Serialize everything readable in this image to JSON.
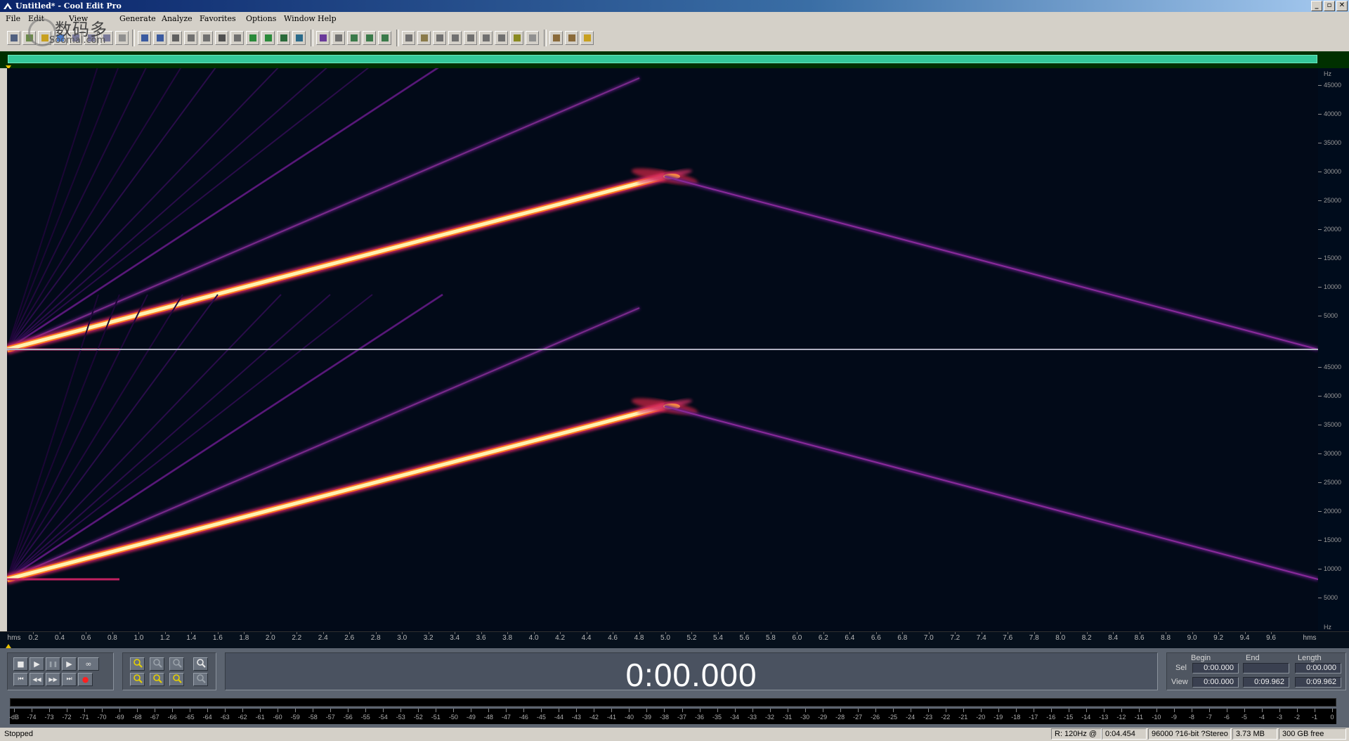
{
  "window": {
    "title": "Untitled* - Cool Edit Pro",
    "controls": [
      "_",
      "▫",
      "✕"
    ]
  },
  "menu": [
    "File",
    "Edit",
    "View",
    "Generate",
    "Analyze",
    "Favorites",
    "Options",
    "Window",
    "Help"
  ],
  "watermark": {
    "cn": "数码多",
    "en": "Soomal.com"
  },
  "spectral": {
    "unit_top": "Hz",
    "unit_bottom": "Hz",
    "freq_labels": [
      "45000",
      "40000",
      "35000",
      "30000",
      "25000",
      "20000",
      "15000",
      "10000",
      "5000"
    ],
    "colors": {
      "background": "#020a18",
      "hot": "#fff6c8",
      "warm": "#ff6a1a",
      "mid": "#c4206a",
      "cool": "#6a1a8a",
      "faint": "#3a1060"
    }
  },
  "timeline": {
    "start_label": "hms",
    "end_label": "hms",
    "ticks": [
      "0.2",
      "0.4",
      "0.6",
      "0.8",
      "1.0",
      "1.2",
      "1.4",
      "1.6",
      "1.8",
      "2.0",
      "2.2",
      "2.4",
      "2.6",
      "2.8",
      "3.0",
      "3.2",
      "3.4",
      "3.6",
      "3.8",
      "4.0",
      "4.2",
      "4.4",
      "4.6",
      "4.8",
      "5.0",
      "5.2",
      "5.4",
      "5.6",
      "5.8",
      "6.0",
      "6.2",
      "6.4",
      "6.6",
      "6.8",
      "7.0",
      "7.2",
      "7.4",
      "7.6",
      "7.8",
      "8.0",
      "8.2",
      "8.4",
      "8.6",
      "8.8",
      "9.0",
      "9.2",
      "9.4",
      "9.6"
    ]
  },
  "transport": {
    "time_display": "0:00.000",
    "row1": [
      "■",
      "▶",
      "❚❚",
      "▶",
      "∞"
    ],
    "row2": [
      "⏮",
      "◀◀",
      "▶▶",
      "⏭",
      "●"
    ]
  },
  "selection": {
    "headers": {
      "begin": "Begin",
      "end": "End",
      "length": "Length"
    },
    "sel": {
      "label": "Sel",
      "begin": "0:00.000",
      "end": "",
      "length": "0:00.000"
    },
    "view": {
      "label": "View",
      "begin": "0:00.000",
      "end": "0:09.962",
      "length": "0:09.962"
    }
  },
  "level_meter": {
    "labels": [
      "-dB",
      "-74",
      "-73",
      "-72",
      "-71",
      "-70",
      "-69",
      "-68",
      "-67",
      "-66",
      "-65",
      "-64",
      "-63",
      "-62",
      "-61",
      "-60",
      "-59",
      "-58",
      "-57",
      "-56",
      "-55",
      "-54",
      "-53",
      "-52",
      "-51",
      "-50",
      "-49",
      "-48",
      "-47",
      "-46",
      "-45",
      "-44",
      "-43",
      "-42",
      "-41",
      "-40",
      "-39",
      "-38",
      "-37",
      "-36",
      "-35",
      "-34",
      "-33",
      "-32",
      "-31",
      "-30",
      "-29",
      "-28",
      "-27",
      "-26",
      "-25",
      "-24",
      "-23",
      "-22",
      "-21",
      "-20",
      "-19",
      "-18",
      "-17",
      "-16",
      "-15",
      "-14",
      "-13",
      "-12",
      "-11",
      "-10",
      "-9",
      "-8",
      "-7",
      "-6",
      "-5",
      "-4",
      "-3",
      "-2",
      "-1",
      "0"
    ]
  },
  "status": {
    "state": "Stopped",
    "resolution": "R: 120Hz @",
    "cursor": "0:04.454",
    "format": "96000 ?16-bit ?Stereo",
    "size": "3.73 MB",
    "free": "300 GB free"
  }
}
